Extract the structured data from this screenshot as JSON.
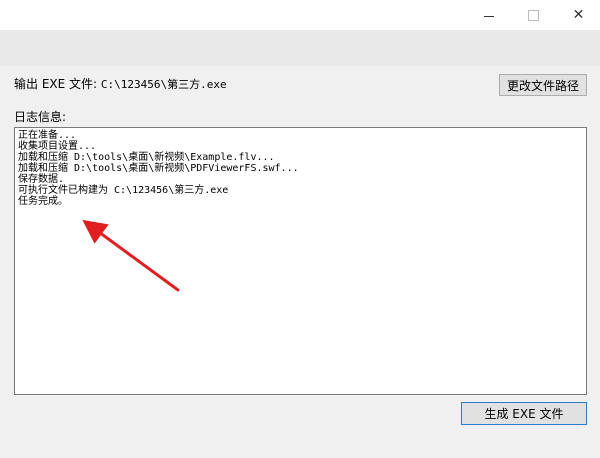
{
  "window": {
    "controls": {
      "minimize_icon": "minimize-icon",
      "maximize_icon": "maximize-icon",
      "close_icon": "close-icon",
      "close_glyph": "✕"
    }
  },
  "output": {
    "label": "输出 EXE 文件:",
    "path": "C:\\123456\\第三方.exe",
    "change_button": "更改文件路径"
  },
  "log": {
    "label": "日志信息:",
    "lines": [
      "正在准备...",
      "收集项目设置...",
      "加载和压缩 D:\\tools\\桌面\\新视频\\Example.flv...",
      "加载和压缩 D:\\tools\\桌面\\新视频\\PDFViewerFS.swf...",
      "保存数据.",
      "可执行文件已构建为 C:\\123456\\第三方.exe",
      "任务完成。"
    ]
  },
  "build_button": "生成 EXE 文件",
  "annotation": {
    "color": "#e02020"
  }
}
